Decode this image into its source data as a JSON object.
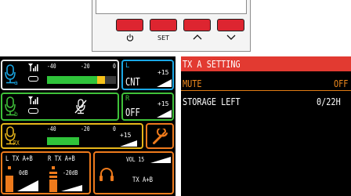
{
  "hardware": {
    "buttons": [
      {
        "name": "power",
        "label": "",
        "icon": "power-icon"
      },
      {
        "name": "set",
        "label": "SET",
        "icon": ""
      },
      {
        "name": "up",
        "label": "",
        "icon": "chevron-up-icon"
      },
      {
        "name": "down",
        "label": "",
        "icon": "chevron-down-icon"
      }
    ]
  },
  "home_screen": {
    "channel_a": {
      "subscript": "a",
      "meter_scale": [
        "-40",
        "-20",
        "0"
      ],
      "level_fraction": 0.84,
      "output_label": "L",
      "output_value": "CNT",
      "gain": "+15",
      "colors": {
        "border": "#1aa8e6",
        "icon": "#1aa8e6"
      }
    },
    "channel_b": {
      "subscript": "b",
      "status_label": "R",
      "status_value": "OFF",
      "gain": "+15",
      "muted": true,
      "colors": {
        "border": "#3fc23a",
        "icon": "#3fc23a"
      }
    },
    "rx": {
      "subscript": "RX",
      "meter_scale": [
        "-40",
        "-20",
        "0"
      ],
      "level_fraction": 0.47,
      "gain": "+15",
      "icon": "wrench-icon",
      "colors": {
        "border": "#e6b51a",
        "icon": "#e6b51a",
        "tool_border": "#ee7a1c"
      }
    },
    "outputs": {
      "left_label": "L TX A+B",
      "right_label": "R TX A+B",
      "left_gain": "0dB",
      "right_gain": "-20dB",
      "volume": "VOL 15",
      "headphone_source": "TX A+B",
      "icon": "headphones-icon",
      "colors": {
        "border": "#ee7a1c"
      }
    }
  },
  "menu": {
    "title": "TX A SETTING",
    "items": [
      {
        "label": "MUTE",
        "value": "OFF",
        "selected": true
      },
      {
        "label": "STORAGE LEFT",
        "value": "0/22H",
        "selected": false
      }
    ],
    "colors": {
      "header_bg": "#e23a31",
      "selected_text": "#f08a1e"
    }
  }
}
